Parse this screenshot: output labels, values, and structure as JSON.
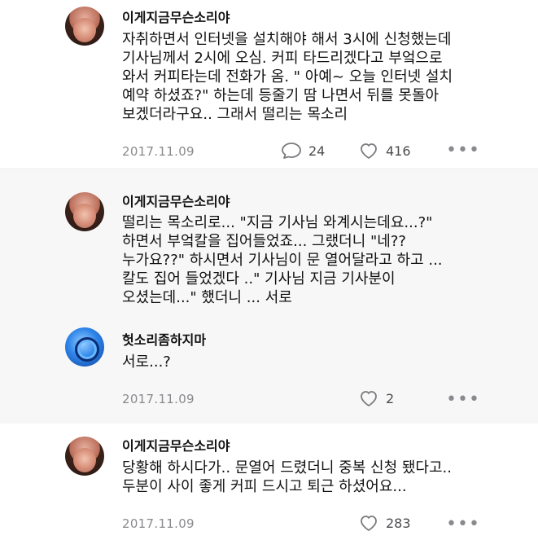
{
  "posts": [
    {
      "username": "이게지금무슨소리야",
      "text": "자취하면서 인터넷을 설치해야 해서 3시에 신청했는데\n기사님께서 2시에 오심. 커피 타드리겠다고 부엌으로\n와서 커피타는데 전화가 옴. \" 아예~ 오늘 인터넷 설치\n예약 하셨죠?\" 하는데 등줄기 땀 나면서 뒤를 못돌아\n보겠더라구요.. 그래서 떨리는 목소리",
      "date": "2017.11.09",
      "comments": "24",
      "likes": "416",
      "more": "•••"
    },
    {
      "username": "이게지금무슨소리야",
      "text": "떨리는 목소리로... \"지금 기사님 와계시는데요...?\"\n하면서 부엌칼을 집어들었죠... 그랬더니 \"네??\n누가요??\" 하시면서 기사님이 문 열어달라고 하고 ...\n칼도 집어 들었겠다 ..\" 기사님 지금 기사분이\n오셨는데...\" 했더니 ... 서로"
    },
    {
      "username": "헛소리좀하지마",
      "text": "서로...?",
      "date": "2017.11.09",
      "likes": "2"
    },
    {
      "username": "이게지금무슨소리야",
      "text": "당황해 하시다가.. 문열어 드렸더니 중복 신청 됐다고..\n두분이 사이 좋게 커피 드시고 퇴근 하셨어요...",
      "date": "2017.11.09",
      "likes": "283"
    }
  ]
}
